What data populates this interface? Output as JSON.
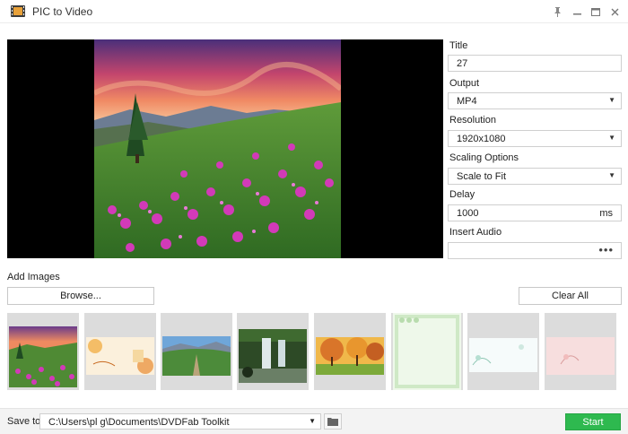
{
  "window": {
    "title": "PIC to Video",
    "controls": [
      "pin-icon",
      "minimize-icon",
      "maximize-icon",
      "close-icon"
    ]
  },
  "settings": {
    "title": {
      "label": "Title",
      "value": "27"
    },
    "output": {
      "label": "Output",
      "value": "MP4"
    },
    "resolution": {
      "label": "Resolution",
      "value": "1920x1080"
    },
    "scaling": {
      "label": "Scaling Options",
      "value": "Scale to Fit"
    },
    "delay": {
      "label": "Delay",
      "value": "1000",
      "unit": "ms"
    },
    "audio": {
      "label": "Insert Audio",
      "value": "",
      "button": "•••"
    }
  },
  "images": {
    "label": "Add Images",
    "browse": "Browse...",
    "clear": "Clear All",
    "thumbnails": [
      {
        "name": "mountain-flowers"
      },
      {
        "name": "autumn-scrapbook"
      },
      {
        "name": "green-hills-path"
      },
      {
        "name": "waterfall"
      },
      {
        "name": "autumn-trees"
      },
      {
        "name": "green-frame"
      },
      {
        "name": "pale-floral"
      },
      {
        "name": "pink-floral"
      }
    ]
  },
  "save": {
    "label": "Save to:",
    "path": "C:\\Users\\pl           g\\Documents\\DVDFab Toolkit",
    "start": "Start"
  },
  "colors": {
    "accent": "#2eb94f",
    "preview_bg": "#000000",
    "thumb_bg": "#dcdcdc"
  }
}
